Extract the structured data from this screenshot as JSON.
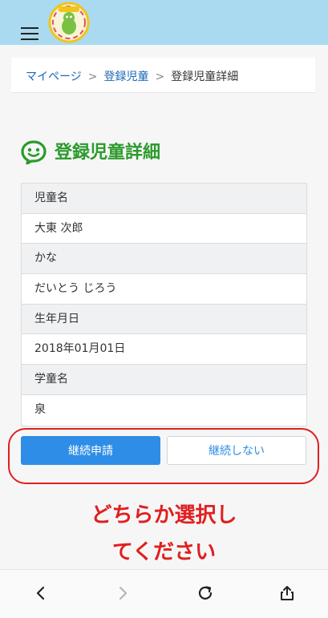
{
  "breadcrumb": {
    "items": [
      "マイページ",
      "登録児童",
      "登録児童詳細"
    ],
    "separator": ">"
  },
  "page": {
    "title": "登録児童詳細"
  },
  "details": [
    {
      "label": "児童名",
      "value": "大東 次郎"
    },
    {
      "label": "かな",
      "value": "だいとう じろう"
    },
    {
      "label": "生年月日",
      "value": "2018年01月01日"
    },
    {
      "label": "学童名",
      "value": "泉"
    }
  ],
  "actions": {
    "continue_label": "継続申請",
    "discontinue_label": "継続しない"
  },
  "annotation": {
    "line1": "どちらか選択し",
    "line2": "てください"
  },
  "colors": {
    "header_bg": "#aadaf0",
    "title_green": "#2b9a2b",
    "primary_blue": "#2e8de6",
    "annotation_red": "#e01f1f"
  },
  "icons": {
    "menu": "hamburger-icon",
    "title": "smile-chat-icon",
    "back": "chevron-left-icon",
    "forward": "chevron-right-icon",
    "reload": "reload-icon",
    "share": "share-icon"
  }
}
